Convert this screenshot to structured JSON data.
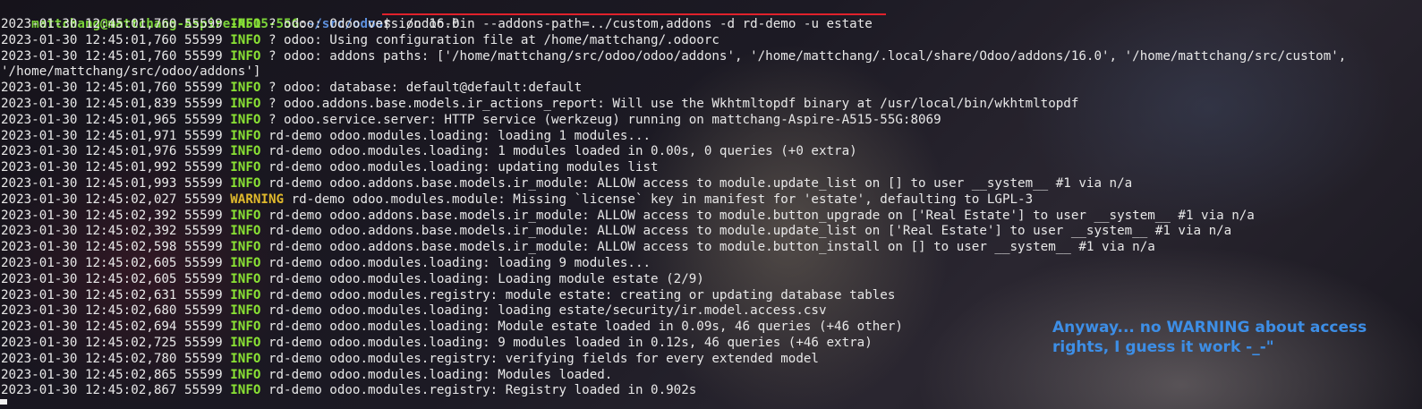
{
  "colors": {
    "info": "#8ae234",
    "warning": "#e0b92c",
    "prompt_user": "#7bd43a",
    "prompt_path": "#5d8fdc",
    "underline": "#e0212b",
    "annotation": "#3d8ee6"
  },
  "prompt": {
    "user_host": "mattchang@mattchang-Aspire-A515-55G",
    "sep": ":",
    "path": "~/src/odoo",
    "symbol": "$ ",
    "command": "./odoo-bin --addons-path=../custom,addons -d rd-demo -u estate"
  },
  "log_lines": [
    {
      "pre": "2023-01-30 12:45:01,760 55599 ",
      "level": "INFO",
      "msg": " ? odoo: Odoo version 16.0"
    },
    {
      "pre": "2023-01-30 12:45:01,760 55599 ",
      "level": "INFO",
      "msg": " ? odoo: Using configuration file at /home/mattchang/.odoorc"
    },
    {
      "pre": "2023-01-30 12:45:01,760 55599 ",
      "level": "INFO",
      "msg": " ? odoo: addons paths: ['/home/mattchang/src/odoo/odoo/addons', '/home/mattchang/.local/share/Odoo/addons/16.0', '/home/mattchang/src/custom',"
    },
    {
      "pre": "",
      "level": "",
      "msg": "'/home/mattchang/src/odoo/addons']"
    },
    {
      "pre": "2023-01-30 12:45:01,760 55599 ",
      "level": "INFO",
      "msg": " ? odoo: database: default@default:default"
    },
    {
      "pre": "2023-01-30 12:45:01,839 55599 ",
      "level": "INFO",
      "msg": " ? odoo.addons.base.models.ir_actions_report: Will use the Wkhtmltopdf binary at /usr/local/bin/wkhtmltopdf"
    },
    {
      "pre": "2023-01-30 12:45:01,965 55599 ",
      "level": "INFO",
      "msg": " ? odoo.service.server: HTTP service (werkzeug) running on mattchang-Aspire-A515-55G:8069"
    },
    {
      "pre": "2023-01-30 12:45:01,971 55599 ",
      "level": "INFO",
      "msg": " rd-demo odoo.modules.loading: loading 1 modules..."
    },
    {
      "pre": "2023-01-30 12:45:01,976 55599 ",
      "level": "INFO",
      "msg": " rd-demo odoo.modules.loading: 1 modules loaded in 0.00s, 0 queries (+0 extra)"
    },
    {
      "pre": "2023-01-30 12:45:01,992 55599 ",
      "level": "INFO",
      "msg": " rd-demo odoo.modules.loading: updating modules list"
    },
    {
      "pre": "2023-01-30 12:45:01,993 55599 ",
      "level": "INFO",
      "msg": " rd-demo odoo.addons.base.models.ir_module: ALLOW access to module.update_list on [] to user __system__ #1 via n/a"
    },
    {
      "pre": "2023-01-30 12:45:02,027 55599 ",
      "level": "WARNING",
      "msg": " rd-demo odoo.modules.module: Missing `license` key in manifest for 'estate', defaulting to LGPL-3"
    },
    {
      "pre": "2023-01-30 12:45:02,392 55599 ",
      "level": "INFO",
      "msg": " rd-demo odoo.addons.base.models.ir_module: ALLOW access to module.button_upgrade on ['Real Estate'] to user __system__ #1 via n/a"
    },
    {
      "pre": "2023-01-30 12:45:02,392 55599 ",
      "level": "INFO",
      "msg": " rd-demo odoo.addons.base.models.ir_module: ALLOW access to module.update_list on ['Real Estate'] to user __system__ #1 via n/a"
    },
    {
      "pre": "2023-01-30 12:45:02,598 55599 ",
      "level": "INFO",
      "msg": " rd-demo odoo.addons.base.models.ir_module: ALLOW access to module.button_install on [] to user __system__ #1 via n/a"
    },
    {
      "pre": "2023-01-30 12:45:02,605 55599 ",
      "level": "INFO",
      "msg": " rd-demo odoo.modules.loading: loading 9 modules..."
    },
    {
      "pre": "2023-01-30 12:45:02,605 55599 ",
      "level": "INFO",
      "msg": " rd-demo odoo.modules.loading: Loading module estate (2/9)"
    },
    {
      "pre": "2023-01-30 12:45:02,631 55599 ",
      "level": "INFO",
      "msg": " rd-demo odoo.modules.registry: module estate: creating or updating database tables"
    },
    {
      "pre": "2023-01-30 12:45:02,680 55599 ",
      "level": "INFO",
      "msg": " rd-demo odoo.modules.loading: loading estate/security/ir.model.access.csv"
    },
    {
      "pre": "2023-01-30 12:45:02,694 55599 ",
      "level": "INFO",
      "msg": " rd-demo odoo.modules.loading: Module estate loaded in 0.09s, 46 queries (+46 other)"
    },
    {
      "pre": "2023-01-30 12:45:02,725 55599 ",
      "level": "INFO",
      "msg": " rd-demo odoo.modules.loading: 9 modules loaded in 0.12s, 46 queries (+46 extra)"
    },
    {
      "pre": "2023-01-30 12:45:02,780 55599 ",
      "level": "INFO",
      "msg": " rd-demo odoo.modules.registry: verifying fields for every extended model"
    },
    {
      "pre": "2023-01-30 12:45:02,865 55599 ",
      "level": "INFO",
      "msg": " rd-demo odoo.modules.loading: Modules loaded."
    },
    {
      "pre": "2023-01-30 12:45:02,867 55599 ",
      "level": "INFO",
      "msg": " rd-demo odoo.modules.registry: Registry loaded in 0.902s"
    }
  ],
  "annotation": {
    "line1": "Anyway... no WARNING about access",
    "line2": "rights, I guess it work -_-\""
  }
}
